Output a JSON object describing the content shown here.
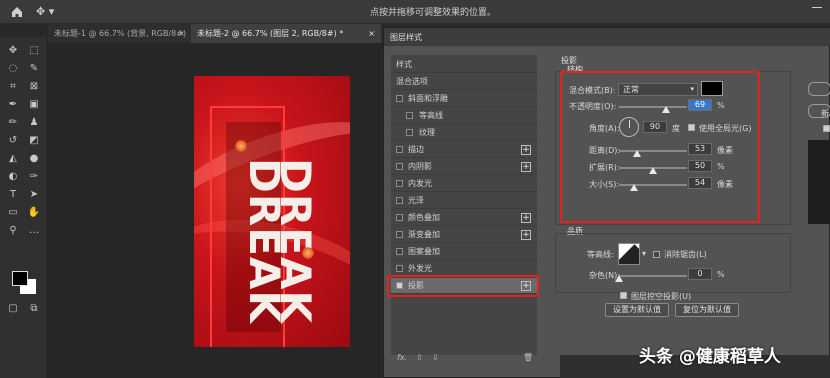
{
  "topbar": {
    "hint": "点按并拖移可调整效果的位置。"
  },
  "tabs": [
    {
      "label": "未标题-1 @ 66.7% (背景, RGB/8#) *",
      "close": "×"
    },
    {
      "label": "未标题-2 @ 66.7% (图层 2, RGB/8#) *",
      "close": "×"
    }
  ],
  "poster": {
    "word1": "DREAK",
    "word2": "DREAK"
  },
  "dialog": {
    "title": "图层样式",
    "styles": [
      {
        "label": "样式",
        "checkbox": false,
        "plus": false
      },
      {
        "label": "混合选项",
        "checkbox": false,
        "plus": false
      },
      {
        "label": "斜面和浮雕",
        "checkbox": true,
        "checked": false,
        "plus": false
      },
      {
        "label": "等高线",
        "checkbox": true,
        "checked": false,
        "plus": false,
        "sub": true
      },
      {
        "label": "纹理",
        "checkbox": true,
        "checked": false,
        "plus": false,
        "sub": true
      },
      {
        "label": "描边",
        "checkbox": true,
        "checked": false,
        "plus": true
      },
      {
        "label": "内阴影",
        "checkbox": true,
        "checked": false,
        "plus": true
      },
      {
        "label": "内发光",
        "checkbox": true,
        "checked": false,
        "plus": false
      },
      {
        "label": "光泽",
        "checkbox": true,
        "checked": false,
        "plus": false
      },
      {
        "label": "颜色叠加",
        "checkbox": true,
        "checked": false,
        "plus": true
      },
      {
        "label": "渐变叠加",
        "checkbox": true,
        "checked": false,
        "plus": true
      },
      {
        "label": "图案叠加",
        "checkbox": true,
        "checked": false,
        "plus": false
      },
      {
        "label": "外发光",
        "checkbox": true,
        "checked": false,
        "plus": false
      },
      {
        "label": "投影",
        "checkbox": true,
        "checked": true,
        "plus": true,
        "active": true
      }
    ],
    "footer": {
      "fx": "fx.",
      "up": "⇧",
      "down": "⇩",
      "trash": "🗑"
    },
    "panel": {
      "title": "投影",
      "structure": "结构",
      "blend_mode_label": "混合模式(B):",
      "blend_mode_value": "正常",
      "opacity_label": "不透明度(O):",
      "opacity_value": "69",
      "opacity_fraction": 0.69,
      "percent": "%",
      "angle_label": "角度(A):",
      "angle_value": "90",
      "degree": "度",
      "global_light_label": "使用全局光(G)",
      "distance_label": "距离(D):",
      "distance_value": "53",
      "distance_fraction": 0.27,
      "spread_label": "扩展(R):",
      "spread_value": "50",
      "spread_fraction": 0.5,
      "size_label": "大小(S):",
      "size_value": "54",
      "size_fraction": 0.22,
      "pixels": "像素",
      "quality": "品质",
      "contour_label": "等高线:",
      "antialias_label": "消除锯齿(L)",
      "noise_label": "杂色(N):",
      "noise_value": "0",
      "noise_fraction": 0,
      "knockout_label": "图层挖空投影(U)",
      "set_default": "设置为默认值",
      "reset_default": "复位为默认值"
    },
    "side": {
      "new_label": "新"
    }
  },
  "watermark": "头条 @健康稻草人",
  "colors": {
    "highlight": "#e5201f",
    "accent": "#3976c4",
    "shadow_color": "#000000"
  }
}
